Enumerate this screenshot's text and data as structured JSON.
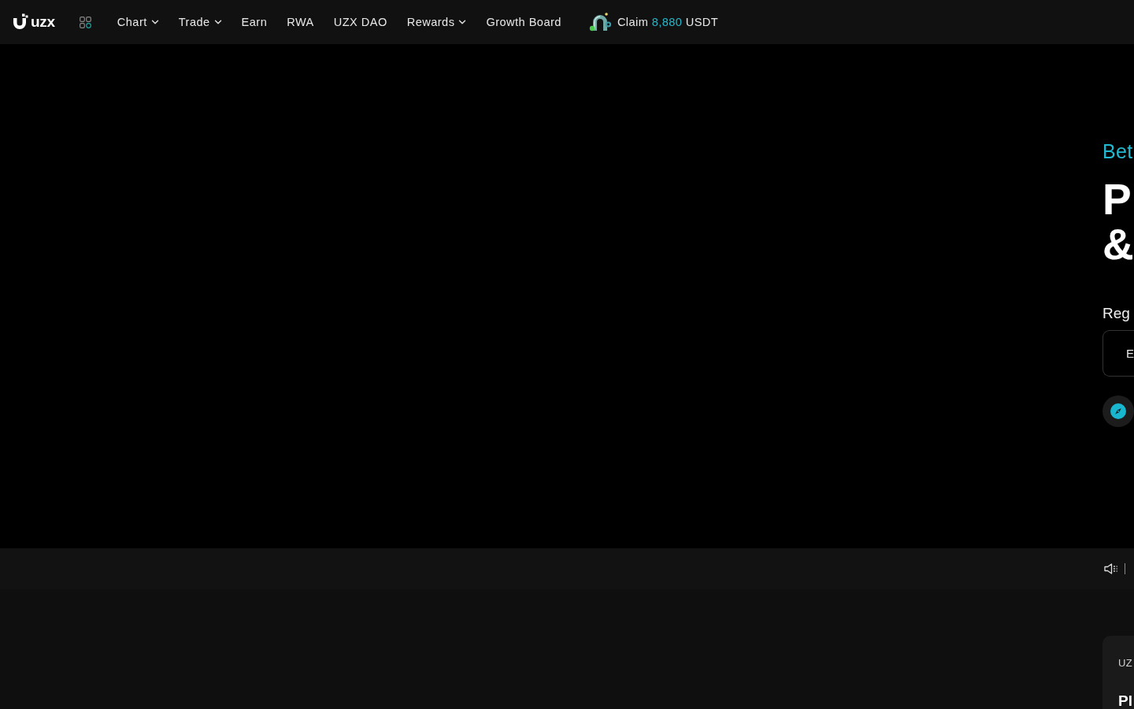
{
  "header": {
    "logo": {
      "text": "uzx"
    },
    "nav": [
      {
        "label": "Chart",
        "dropdown": true
      },
      {
        "label": "Trade",
        "dropdown": true
      },
      {
        "label": "Earn",
        "dropdown": false
      },
      {
        "label": "RWA",
        "dropdown": false
      },
      {
        "label": "UZX DAO",
        "dropdown": false
      },
      {
        "label": "Rewards",
        "dropdown": true
      },
      {
        "label": "Growth Board",
        "dropdown": false
      }
    ],
    "claim": {
      "label": "Claim",
      "amount": "8,880",
      "unit": "USDT"
    }
  },
  "hero": {
    "eyebrow": "Bet",
    "title_lines": [
      "P",
      "&"
    ],
    "register_label": "Reg",
    "input": {
      "placeholder": "E"
    }
  },
  "card": {
    "label": "UZ",
    "title": "Pl"
  }
}
